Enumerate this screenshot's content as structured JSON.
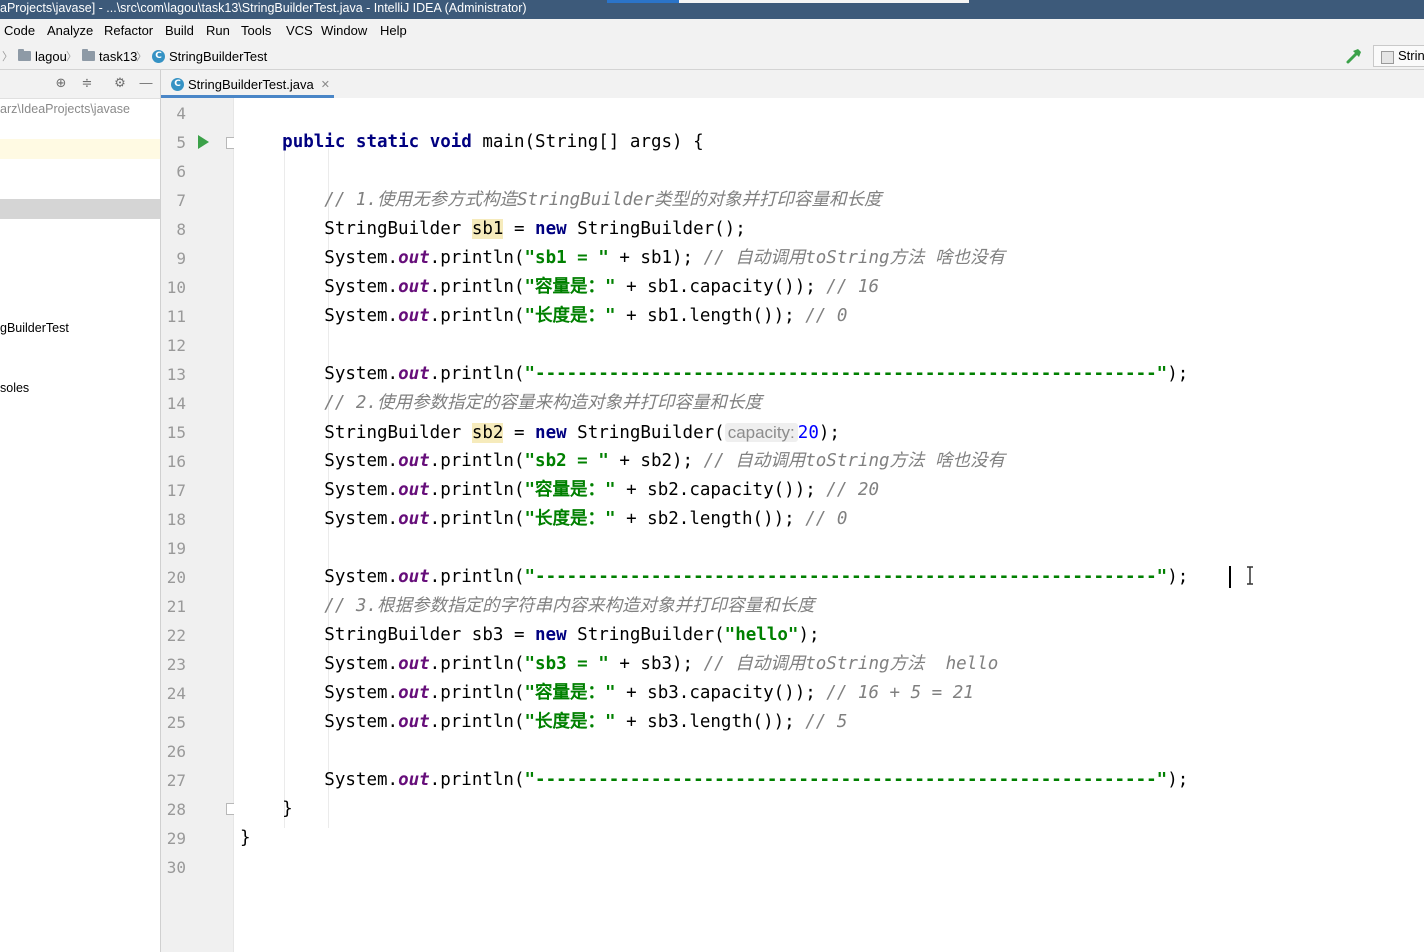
{
  "window": {
    "title": "aProjects\\javase] - ...\\src\\com\\lagou\\task13\\StringBuilderTest.java - IntelliJ IDEA (Administrator)"
  },
  "menu": [
    "Code",
    "Analyze",
    "Refactor",
    "Build",
    "Run",
    "Tools",
    "VCS",
    "Window",
    "Help"
  ],
  "breadcrumb": [
    "lagou",
    "task13",
    "StringBuilderTest"
  ],
  "run_config": {
    "label": "Strin"
  },
  "project_panel": {
    "path": "arz\\IdeaProjects\\javase",
    "tree_items": [
      "gBuilderTest",
      "soles"
    ]
  },
  "editor": {
    "tab": {
      "label": "StringBuilderTest.java"
    },
    "line_numbers": [
      "4",
      "5",
      "6",
      "7",
      "8",
      "9",
      "10",
      "11",
      "12",
      "13",
      "14",
      "15",
      "16",
      "17",
      "18",
      "19",
      "20",
      "21",
      "22",
      "23",
      "24",
      "25",
      "26",
      "27",
      "28",
      "29",
      "30"
    ],
    "code": {
      "line5_public": "public",
      "line5_static": "static",
      "line5_void": "void",
      "line5_rest": " main(String[] args) {",
      "line7_comment": "// 1.使用无参方式构造StringBuilder类型的对象并打印容量和长度",
      "line8_type": "StringBuilder ",
      "line8_var": "sb1",
      "line8_eq": " = ",
      "line8_new": "new",
      "line8_rest": " StringBuilder();",
      "line9_a": "System.",
      "line9_out": "out",
      "line9_b": ".println(",
      "line9_str": "\"sb1 = \"",
      "line9_c": " + sb1); ",
      "line9_comment": "// 自动调用toString方法 啥也没有",
      "line10_a": "System.",
      "line10_out": "out",
      "line10_b": ".println(",
      "line10_str": "\"容量是：\"",
      "line10_c": " + sb1.capacity()); ",
      "line10_comment": "// 16",
      "line11_a": "System.",
      "line11_out": "out",
      "line11_b": ".println(",
      "line11_str": "\"长度是：\"",
      "line11_c": " + sb1.length()); ",
      "line11_comment": "// 0",
      "line13_a": "System.",
      "line13_out": "out",
      "line13_b": ".println(",
      "line13_str": "\"-----------------------------------------------------------\"",
      "line13_c": ");",
      "line14_comment": "// 2.使用参数指定的容量来构造对象并打印容量和长度",
      "line15_type": "StringBuilder ",
      "line15_var": "sb2",
      "line15_eq": " = ",
      "line15_new": "new",
      "line15_rest": " StringBuilder(",
      "line15_hint": "capacity:",
      "line15_num": "20",
      "line15_end": ");",
      "line16_a": "System.",
      "line16_out": "out",
      "line16_b": ".println(",
      "line16_str": "\"sb2 = \"",
      "line16_c": " + sb2); ",
      "line16_comment": "// 自动调用toString方法 啥也没有",
      "line17_a": "System.",
      "line17_out": "out",
      "line17_b": ".println(",
      "line17_str": "\"容量是：\"",
      "line17_c": " + sb2.capacity()); ",
      "line17_comment": "// 20",
      "line18_a": "System.",
      "line18_out": "out",
      "line18_b": ".println(",
      "line18_str": "\"长度是：\"",
      "line18_c": " + sb2.length()); ",
      "line18_comment": "// 0",
      "line20_a": "System.",
      "line20_out": "out",
      "line20_b": ".println(",
      "line20_str": "\"-----------------------------------------------------------\"",
      "line20_c": ");",
      "line21_comment": "// 3.根据参数指定的字符串内容来构造对象并打印容量和长度",
      "line22_type": "StringBuilder sb3 = ",
      "line22_new": "new",
      "line22_rest": " StringBuilder(",
      "line22_str": "\"hello\"",
      "line22_end": ");",
      "line23_a": "System.",
      "line23_out": "out",
      "line23_b": ".println(",
      "line23_str": "\"sb3 = \"",
      "line23_c": " + sb3); ",
      "line23_comment": "// 自动调用toString方法  hello",
      "line24_a": "System.",
      "line24_out": "out",
      "line24_b": ".println(",
      "line24_str": "\"容量是：\"",
      "line24_c": " + sb3.capacity()); ",
      "line24_comment": "// 16 + 5 = 21",
      "line25_a": "System.",
      "line25_out": "out",
      "line25_b": ".println(",
      "line25_str": "\"长度是：\"",
      "line25_c": " + sb3.length()); ",
      "line25_comment": "// 5",
      "line27_a": "System.",
      "line27_out": "out",
      "line27_b": ".println(",
      "line27_str": "\"-----------------------------------------------------------\"",
      "line27_c": ");",
      "line28": "}",
      "line29": "}"
    }
  },
  "colors": {
    "keyword": "#000080",
    "string": "#008000",
    "comment": "#808080",
    "field": "#660e7a",
    "number": "#0000ff",
    "caret_line": "#fffae3",
    "title_bar": "#3d5a7a"
  }
}
